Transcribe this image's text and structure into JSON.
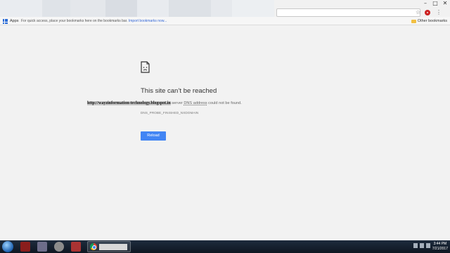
{
  "bookmarks_bar": {
    "apps_label": "Apps",
    "hint_text": "For quick access, place your bookmarks here on the bookmarks bar.",
    "import_link": "Import bookmarks now...",
    "other_bookmarks": "Other bookmarks"
  },
  "error_page": {
    "title": "This site can’t be reached",
    "url": "http://wayzinformation-technology.blogspot.in",
    "message_prefix": " server ",
    "dns_label": "DNS address",
    "message_suffix": " could not be found.",
    "error_code": "DNS_PROBE_FINISHED_NXDOMAIN",
    "reload_label": "Reload"
  },
  "taskbar": {
    "time": "3:44 PM",
    "date": "7/21/2017"
  },
  "icons": {
    "error_page_icon": "sad-document-icon",
    "bookmark_star": "star-icon",
    "extension": "extension-icon",
    "menu": "menu-icon"
  },
  "colors": {
    "reload_button": "#4285f4",
    "page_background": "#f2f2f2",
    "taskbar": "#1d2b3d"
  }
}
